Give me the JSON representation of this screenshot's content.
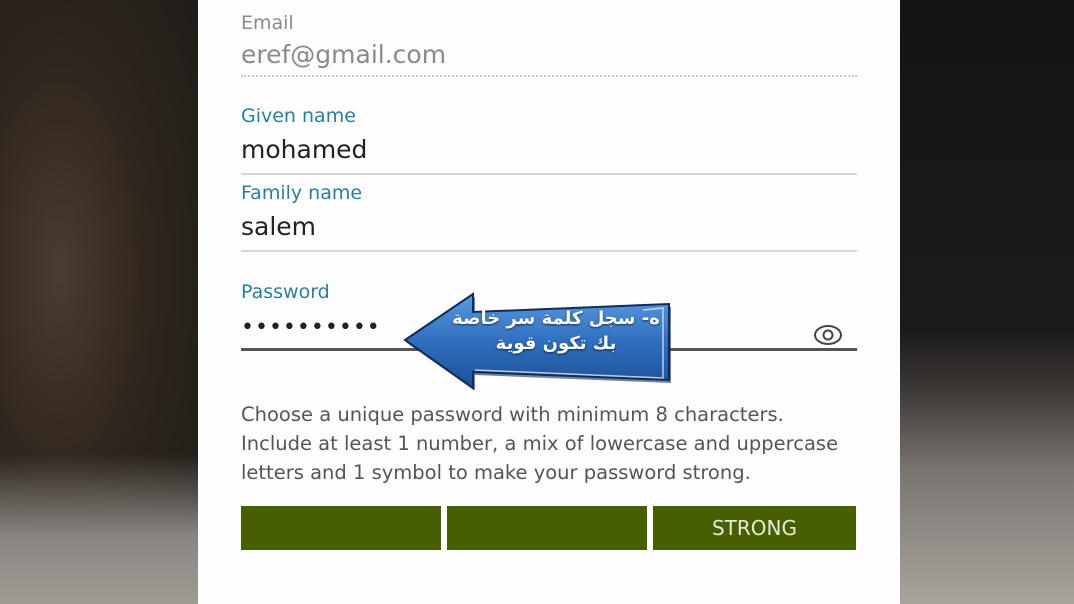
{
  "form": {
    "email": {
      "label": "Email",
      "value": "eref@gmail.com"
    },
    "given_name": {
      "label": "Given name",
      "value": "mohamed"
    },
    "family_name": {
      "label": "Family name",
      "value": "salem"
    },
    "password": {
      "label": "Password",
      "value": "••••••••••",
      "toggle_icon": "eye-icon"
    },
    "password_help": "Choose a unique password with minimum 8 characters. Include at least 1 number, a mix of lowercase and uppercase letters and 1 symbol to make your password strong.",
    "strength": {
      "label": "STRONG",
      "level": 3,
      "max_level": 3
    }
  },
  "annotation": {
    "line1": "ه- سجل كلمة سر خاصة",
    "line2": "بك تكون قوية"
  },
  "colors": {
    "accent_label": "#2a7fa0",
    "strength_bar": "#466000",
    "callout_fill": "#3a7fc4"
  }
}
